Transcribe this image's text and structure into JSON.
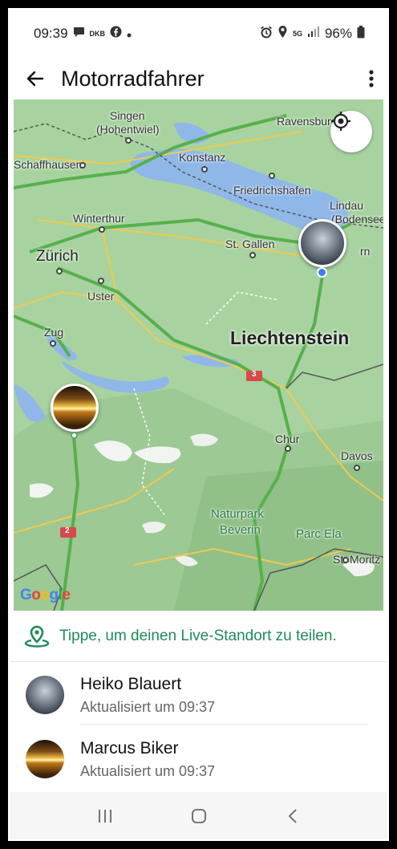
{
  "status_bar": {
    "time": "09:39",
    "notification_icons": [
      "chat-icon",
      "dkb-icon",
      "facebook-icon",
      "dot-icon"
    ],
    "dkb_label": "DKB",
    "right_icons": [
      "alarm-icon",
      "location-icon",
      "5g-icon",
      "signal-icon"
    ],
    "network": "5G",
    "battery": "96%"
  },
  "app_bar": {
    "title": "Motorradfahrer"
  },
  "map": {
    "attribution": "Google",
    "places": {
      "singen": "Singen",
      "hohentwiel": "(Hohentwiel)",
      "ravensburg": "Ravensburg",
      "schaffhausen": "Schaffhausen",
      "konstanz": "Konstanz",
      "friedrichshafen": "Friedrichshafen",
      "lindau": "Lindau",
      "bodensee": "(Bodensee)",
      "winterthur": "Winterthur",
      "stgallen": "St. Gallen",
      "zurich": "Zürich",
      "uster": "Uster",
      "zug": "Zug",
      "liechtenstein": "Liechtenstein",
      "chur": "Chur",
      "davos": "Davos",
      "naturpark": "Naturpark",
      "beverin": "Beverin",
      "parcela": "Parc Ela",
      "stmoritz": "St. Moritz",
      "route3": "3",
      "route2": "2",
      "dornbirn_suffix": "rn"
    }
  },
  "share_prompt": "Tippe, um deinen Live-Standort zu teilen.",
  "contacts": [
    {
      "name": "Heiko Blauert",
      "updated": "Aktualisiert um 09:37"
    },
    {
      "name": "Marcus Biker",
      "updated": "Aktualisiert um 09:37"
    }
  ],
  "colors": {
    "accent_green": "#1f8b5a",
    "map_green": "#a8d3a0",
    "water": "#8fb8e8",
    "road_yellow": "#f2c94c",
    "highway_green": "#56b04c"
  }
}
